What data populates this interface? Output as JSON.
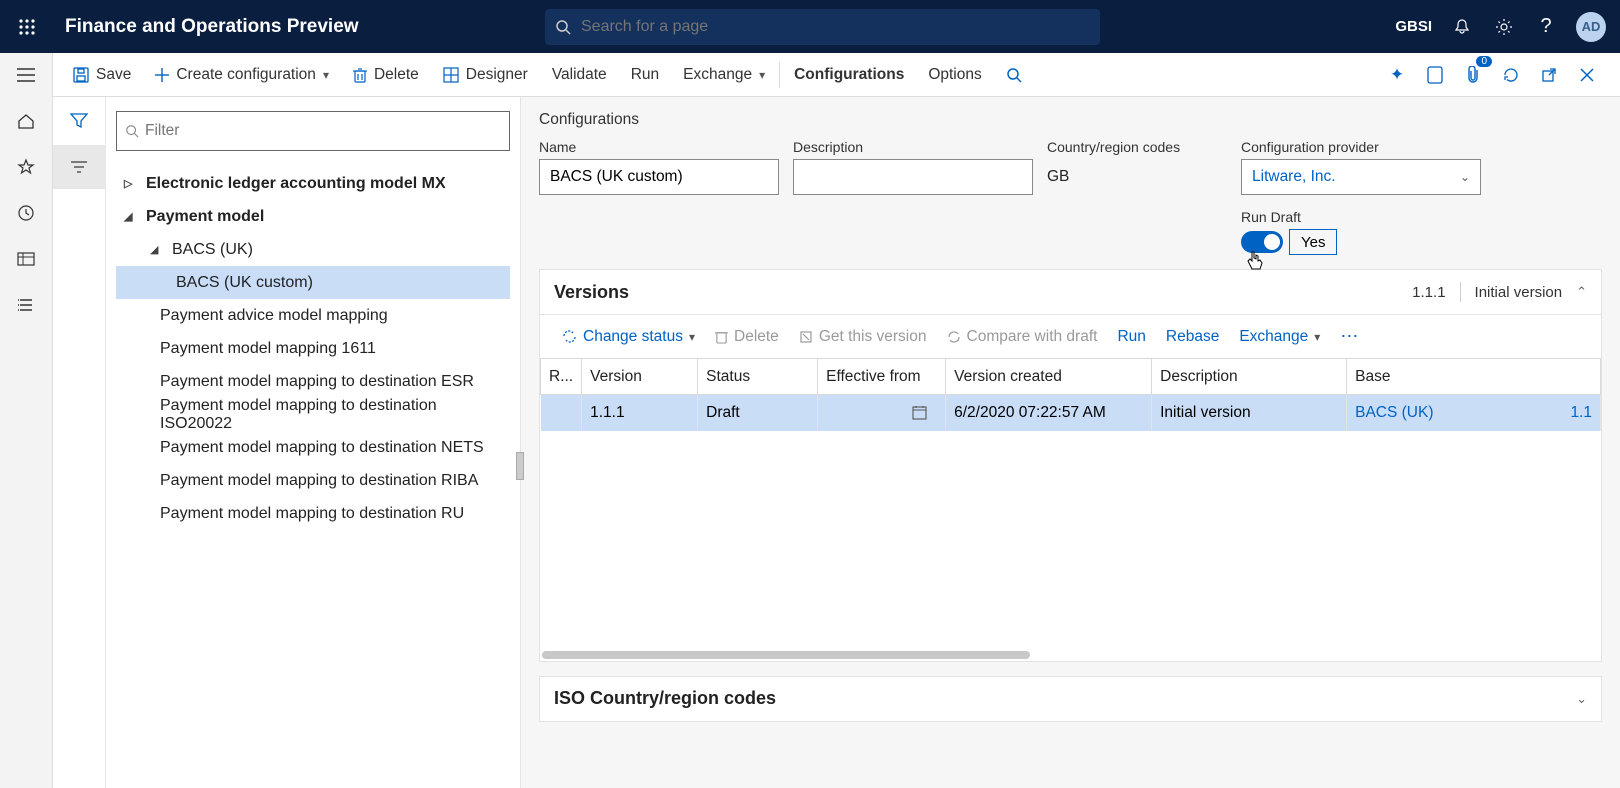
{
  "header": {
    "app_title": "Finance and Operations Preview",
    "search_placeholder": "Search for a page",
    "company": "GBSI",
    "avatar": "AD"
  },
  "cmdbar": {
    "save": "Save",
    "create_config": "Create configuration",
    "delete": "Delete",
    "designer": "Designer",
    "validate": "Validate",
    "run": "Run",
    "exchange": "Exchange",
    "configurations": "Configurations",
    "options": "Options",
    "notif_count": "0"
  },
  "tree_filter_placeholder": "Filter",
  "tree": {
    "root1": "Electronic ledger accounting model MX",
    "root2": "Payment model",
    "n1": "BACS (UK)",
    "n1a": "BACS (UK custom)",
    "n2": "Payment advice model mapping",
    "n3": "Payment model mapping 1611",
    "n4": "Payment model mapping to destination ESR",
    "n5": "Payment model mapping to destination ISO20022",
    "n6": "Payment model mapping to destination NETS",
    "n7": "Payment model mapping to destination RIBA",
    "n8": "Payment model mapping to destination RU"
  },
  "config": {
    "section_title": "Configurations",
    "name_lbl": "Name",
    "name_val": "BACS (UK custom)",
    "desc_lbl": "Description",
    "desc_val": "",
    "region_lbl": "Country/region codes",
    "region_val": "GB",
    "provider_lbl": "Configuration provider",
    "provider_val": "Litware, Inc.",
    "rundraft_lbl": "Run Draft",
    "rundraft_val": "Yes"
  },
  "versions": {
    "title": "Versions",
    "summary_ver": "1.1.1",
    "summary_desc": "Initial version",
    "actions": {
      "change_status": "Change status",
      "delete": "Delete",
      "get": "Get this version",
      "compare": "Compare with draft",
      "run": "Run",
      "rebase": "Rebase",
      "exchange": "Exchange"
    },
    "cols": {
      "r": "R...",
      "version": "Version",
      "status": "Status",
      "eff": "Effective from",
      "created": "Version created",
      "desc": "Description",
      "base": "Base"
    },
    "row": {
      "version": "1.1.1",
      "status": "Draft",
      "created": "6/2/2020 07:22:57 AM",
      "desc": "Initial version",
      "base": "BACS (UK)",
      "base_ver": "1.1"
    }
  },
  "iso": {
    "title": "ISO Country/region codes"
  }
}
